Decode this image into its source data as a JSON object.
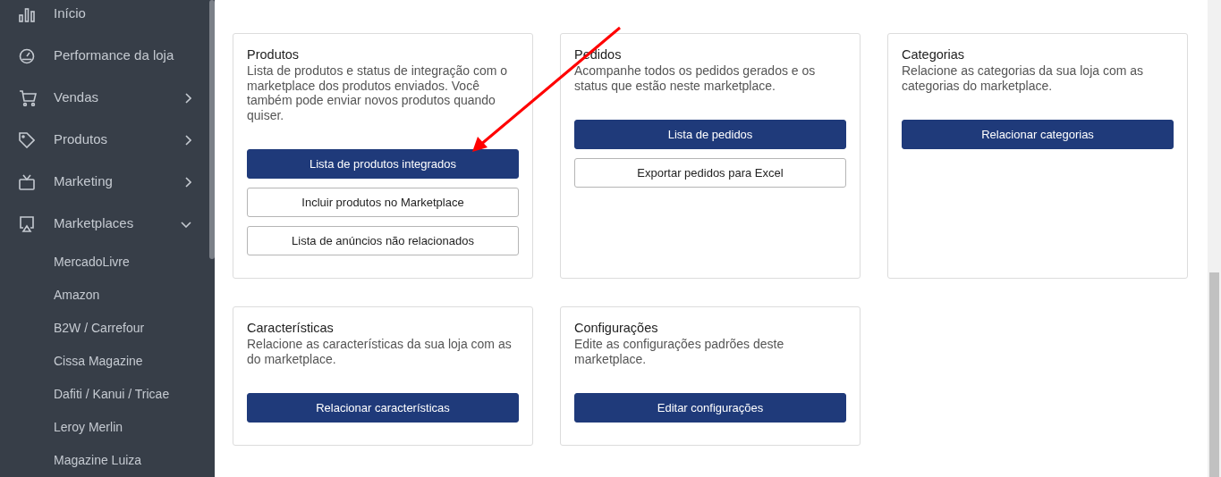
{
  "sidebar": {
    "items": [
      {
        "label": "Início"
      },
      {
        "label": "Performance da loja"
      },
      {
        "label": "Vendas",
        "expanded": false
      },
      {
        "label": "Produtos",
        "expanded": false
      },
      {
        "label": "Marketing",
        "expanded": false
      },
      {
        "label": "Marketplaces",
        "expanded": true,
        "children": [
          {
            "label": "MercadoLivre"
          },
          {
            "label": "Amazon"
          },
          {
            "label": "B2W / Carrefour"
          },
          {
            "label": "Cissa Magazine"
          },
          {
            "label": "Dafiti / Kanui / Tricae"
          },
          {
            "label": "Leroy Merlin"
          },
          {
            "label": "Magazine Luiza"
          }
        ]
      }
    ]
  },
  "cards": [
    {
      "title": "Produtos",
      "description": "Lista de produtos e status de integração com o marketplace dos produtos enviados. Você também pode enviar novos produtos quando quiser.",
      "buttons": [
        {
          "label": "Lista de produtos integrados",
          "kind": "primary"
        },
        {
          "label": "Incluir produtos no Marketplace",
          "kind": "outline"
        },
        {
          "label": "Lista de anúncios não relacionados",
          "kind": "outline"
        }
      ]
    },
    {
      "title": "Pedidos",
      "description": "Acompanhe todos os pedidos gerados e os status que estão neste marketplace.",
      "buttons": [
        {
          "label": "Lista de pedidos",
          "kind": "primary"
        },
        {
          "label": "Exportar pedidos para Excel",
          "kind": "outline"
        }
      ]
    },
    {
      "title": "Categorias",
      "description": "Relacione as categorias da sua loja com as categorias do marketplace.",
      "buttons": [
        {
          "label": "Relacionar categorias",
          "kind": "primary"
        }
      ]
    },
    {
      "title": "Características",
      "description": "Relacione as características da sua loja com as do marketplace.",
      "buttons": [
        {
          "label": "Relacionar características",
          "kind": "primary"
        }
      ]
    },
    {
      "title": "Configurações",
      "description": "Edite as configurações padrões deste marketplace.",
      "buttons": [
        {
          "label": "Editar configurações",
          "kind": "primary"
        }
      ]
    }
  ]
}
